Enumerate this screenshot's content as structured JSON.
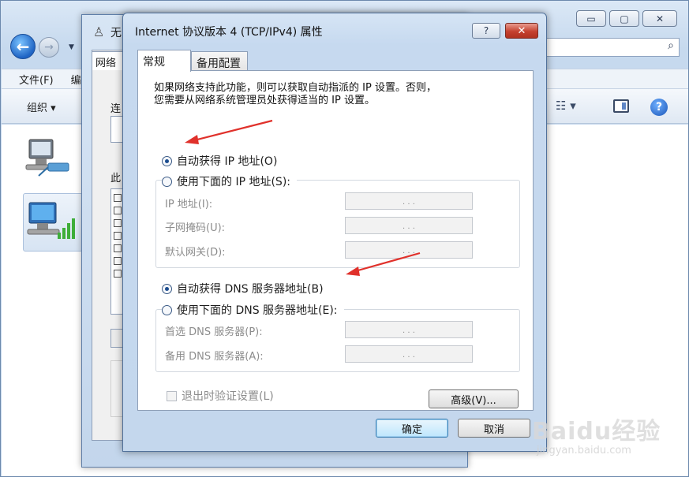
{
  "explorer": {
    "window_buttons": [
      "▭",
      "▢",
      "✕"
    ],
    "menu": [
      "文件(F)",
      "编"
    ],
    "toolbar_organize": "组织 ▾"
  },
  "mid_window": {
    "title": "无",
    "tab": "网络",
    "connect_label": "连",
    "items_label": "此",
    "list_checks": [
      "✓",
      "✓",
      "✓",
      "✓",
      "✓",
      "✓",
      "✓"
    ]
  },
  "dialog": {
    "title": "Internet 协议版本 4 (TCP/IPv4) 属性",
    "help_button": "?",
    "close_button": "✕",
    "tabs": [
      "常规",
      "备用配置"
    ],
    "description_line1": "如果网络支持此功能，则可以获取自动指派的 IP 设置。否则，",
    "description_line2": "您需要从网络系统管理员处获得适当的 IP 设置。",
    "auto_ip": "自动获得 IP 地址(O)",
    "manual_ip": "使用下面的 IP 地址(S):",
    "ip_address_label": "IP 地址(I):",
    "subnet_label": "子网掩码(U):",
    "gateway_label": "默认网关(D):",
    "auto_dns": "自动获得 DNS 服务器地址(B)",
    "manual_dns": "使用下面的 DNS 服务器地址(E):",
    "preferred_dns_label": "首选 DNS 服务器(P):",
    "alternate_dns_label": "备用 DNS 服务器(A):",
    "ip_dots": ".   .   .",
    "validate_on_exit": "退出时验证设置(L)",
    "advanced_button": "高级(V)...",
    "ok_button": "确定",
    "cancel_button": "取消",
    "selected": {
      "ip": "auto",
      "dns": "auto"
    }
  },
  "watermark": {
    "logo": "Baidu经验",
    "url": "jingyan.baidu.com"
  },
  "colors": {
    "annotation_arrow": "#e0312b",
    "title_bar": "#c6d9ef",
    "close_button": "#c5412f"
  }
}
